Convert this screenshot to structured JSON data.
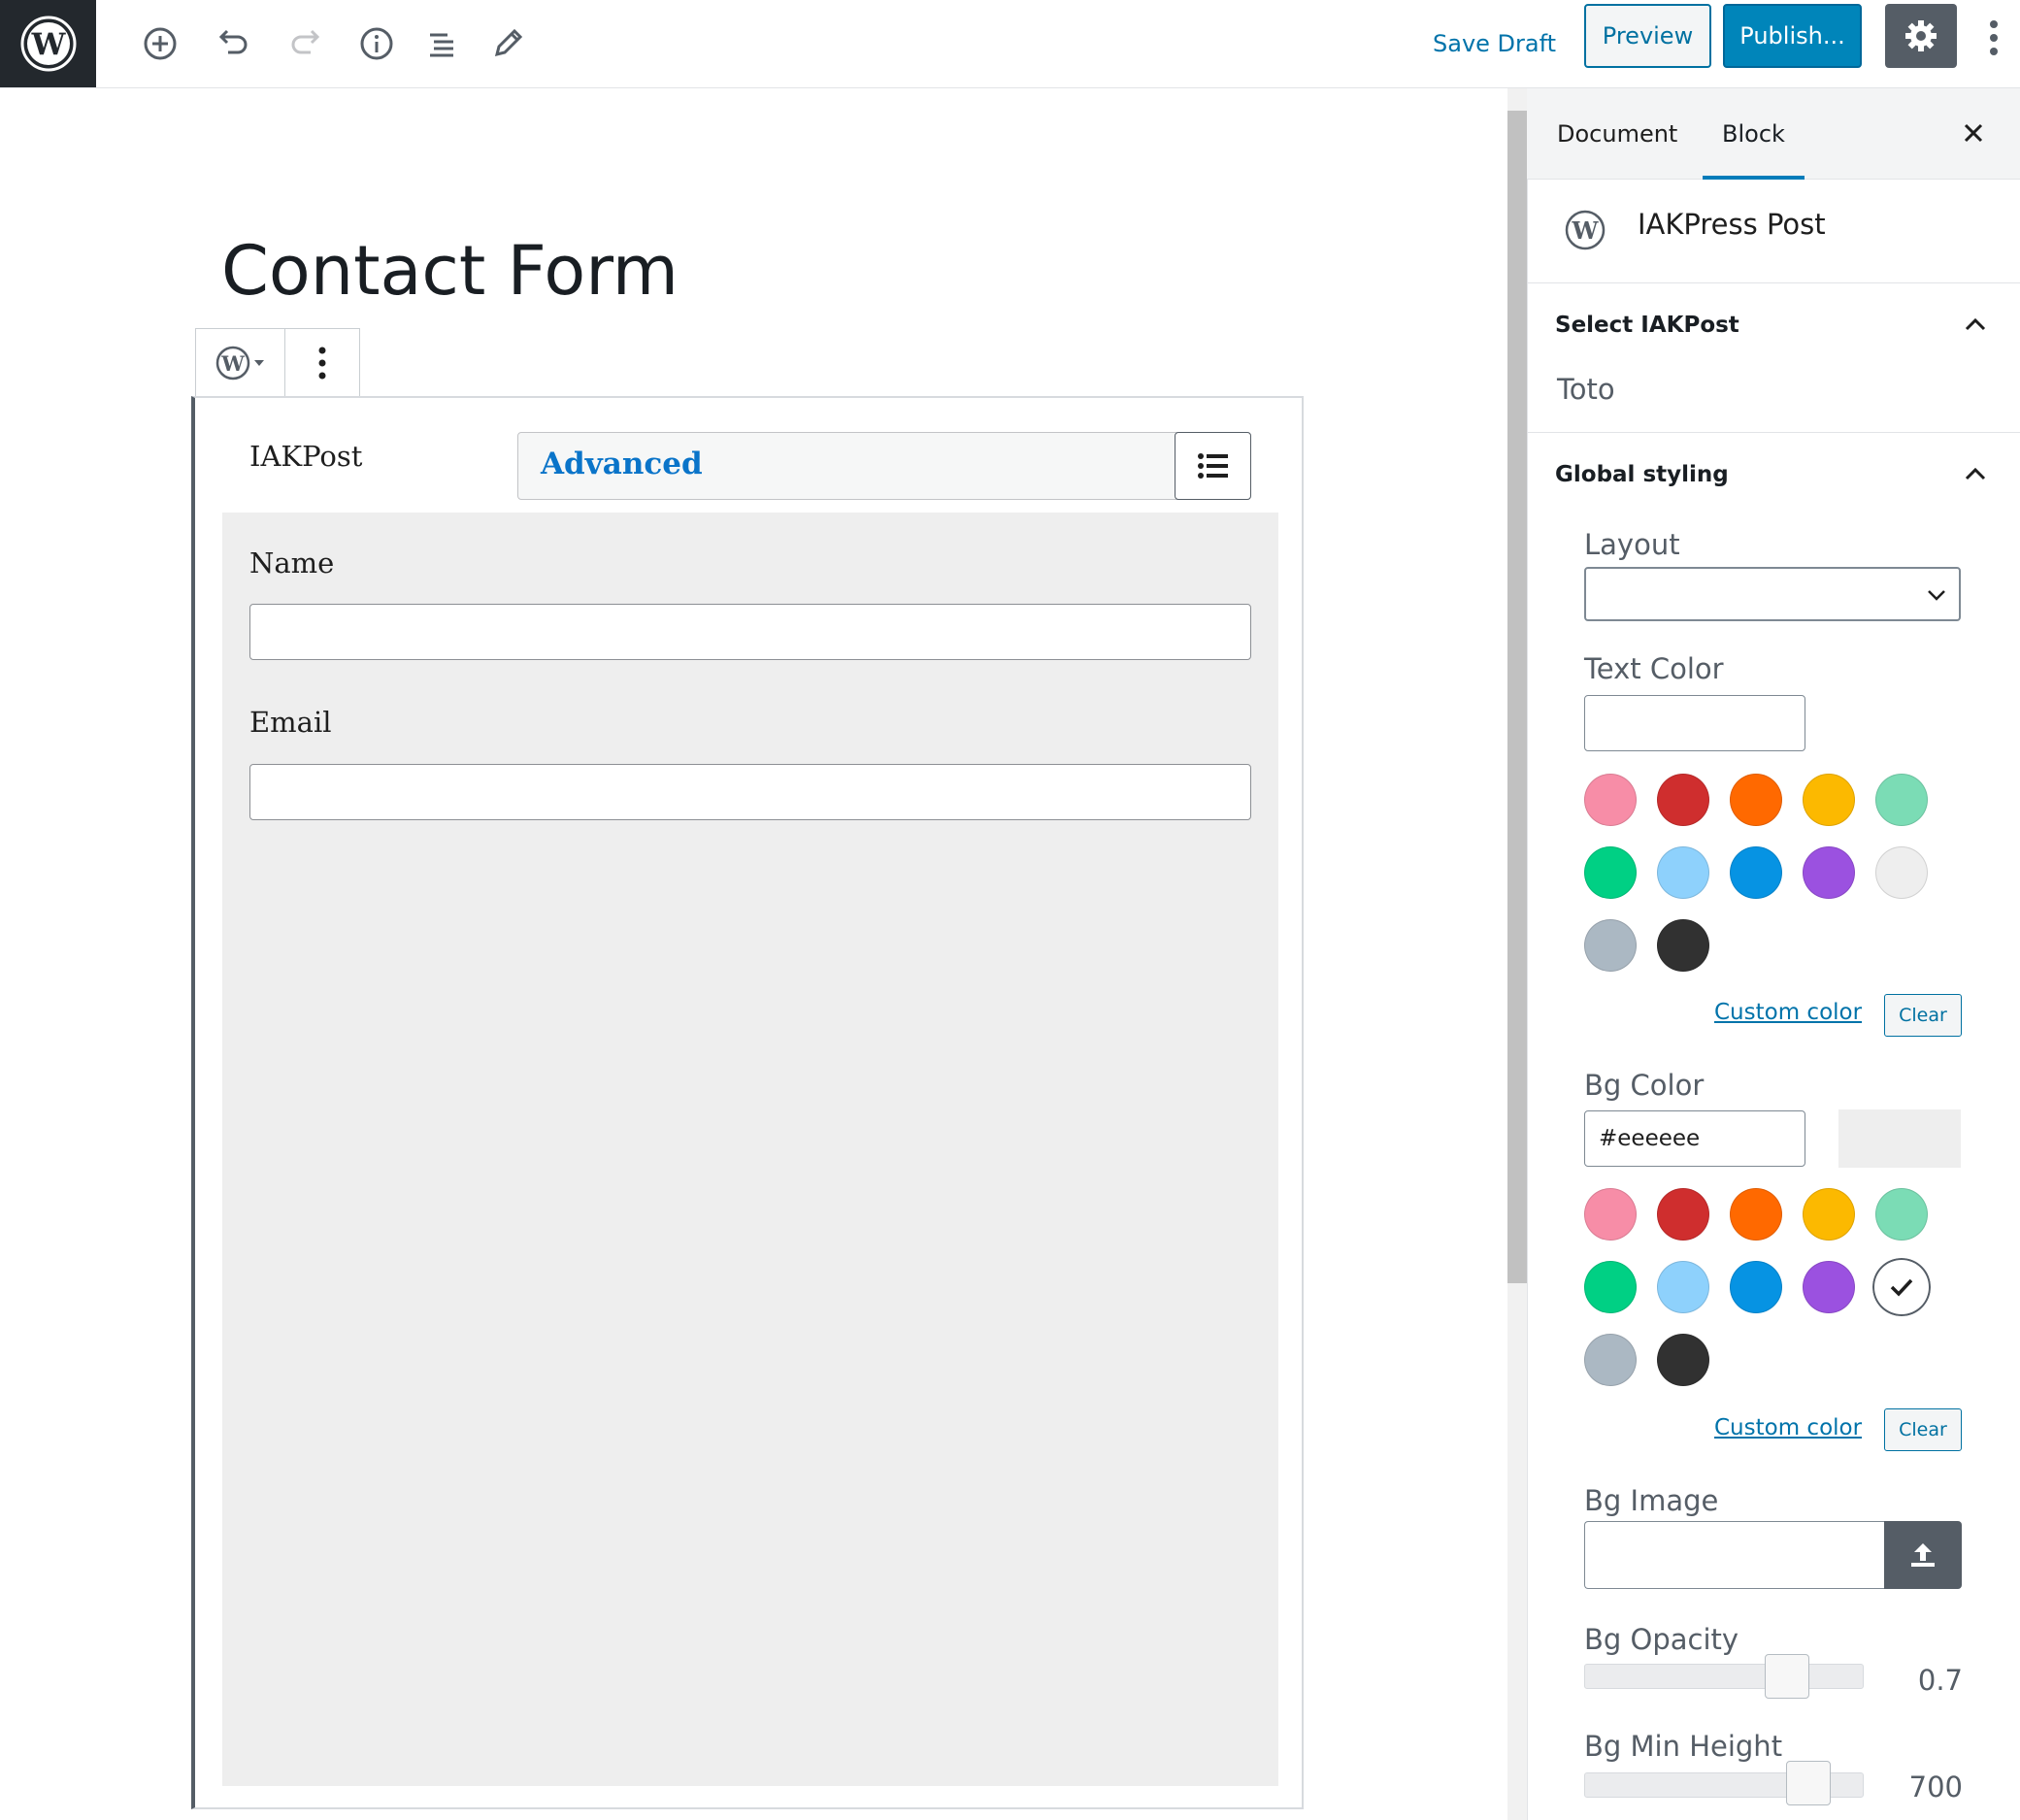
{
  "toolbar": {
    "add_block_icon": "plus-circle-icon",
    "undo_icon": "undo-icon",
    "redo_icon": "redo-icon",
    "info_icon": "info-icon",
    "outline_icon": "list-outline-icon",
    "tools_icon": "pencil-icon",
    "save_draft": "Save Draft",
    "preview": "Preview",
    "publish": "Publish...",
    "settings_icon": "gear-icon",
    "more_icon": "vertical-ellipsis-icon"
  },
  "post": {
    "title": "Contact Form"
  },
  "block": {
    "label": "IAKPost",
    "mode": "Advanced",
    "fields": [
      {
        "label": "Name",
        "value": ""
      },
      {
        "label": "Email",
        "value": ""
      }
    ]
  },
  "sidebar": {
    "tabs": [
      "Document",
      "Block"
    ],
    "active_tab": "Block",
    "block_name": "IAKPress Post",
    "panel_select": {
      "title": "Select IAKPost",
      "value": "Toto"
    },
    "panel_global": {
      "title": "Global styling",
      "layout_label": "Layout",
      "layout_value": "",
      "text_color_label": "Text Color",
      "text_color_value": "",
      "bg_color_label": "Bg Color",
      "bg_color_value": "#eeeeee",
      "custom_color": "Custom color",
      "clear": "Clear",
      "bg_image_label": "Bg Image",
      "bg_opacity_label": "Bg Opacity",
      "bg_opacity_value": "0.7",
      "bg_opacity_fraction": 0.7,
      "bg_min_height_label": "Bg Min Height",
      "bg_min_height_value": "700"
    },
    "palette": [
      "#f78da7",
      "#cf2e2e",
      "#ff6900",
      "#fcb900",
      "#7bdcb5",
      "#00d084",
      "#8ed1fc",
      "#0693e3",
      "#9b51e0",
      "#eeeeee",
      "#abb8c3",
      "#313131"
    ],
    "bg_selected_index": 9
  },
  "colors": {
    "accent": "#0085ba",
    "link": "#0073aa",
    "dark": "#23282d"
  }
}
